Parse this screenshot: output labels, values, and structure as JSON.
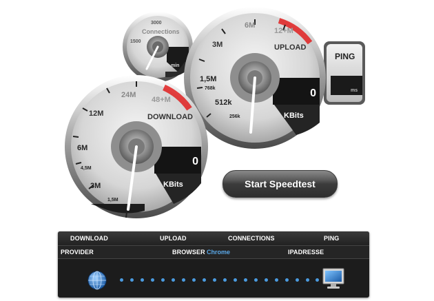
{
  "download_gauge": {
    "title": "DOWNLOAD",
    "scale_labels": [
      "1,5M",
      "3M",
      "4,5M",
      "6M",
      "12M",
      "24M",
      "48+M"
    ],
    "value": "0",
    "unit": "KBits"
  },
  "upload_gauge": {
    "title": "UPLOAD",
    "scale_labels": [
      "256k",
      "512k",
      "768k",
      "1,5M",
      "3M",
      "6M",
      "12+M"
    ],
    "value": "0",
    "unit": "KBits"
  },
  "connections_gauge": {
    "title": "Connections",
    "scale_labels": [
      "1500",
      "3000"
    ],
    "unit": "min"
  },
  "ping_tab": {
    "title": "PING",
    "unit": "ms"
  },
  "start_button": {
    "label": "Start Speedtest"
  },
  "results_panel": {
    "headers": [
      "DOWNLOAD",
      "UPLOAD",
      "CONNECTIONS",
      "PING"
    ],
    "provider_label": "PROVIDER",
    "browser_label": "BROWSER",
    "browser_value": "Chrome",
    "ipaddress_label": "IPADRESSE"
  },
  "colors": {
    "accent_red": "#e02020",
    "link_blue": "#5aa8e8",
    "panel_bg": "#1c1c1c"
  },
  "icons": [
    "globe-icon",
    "monitor-icon"
  ]
}
